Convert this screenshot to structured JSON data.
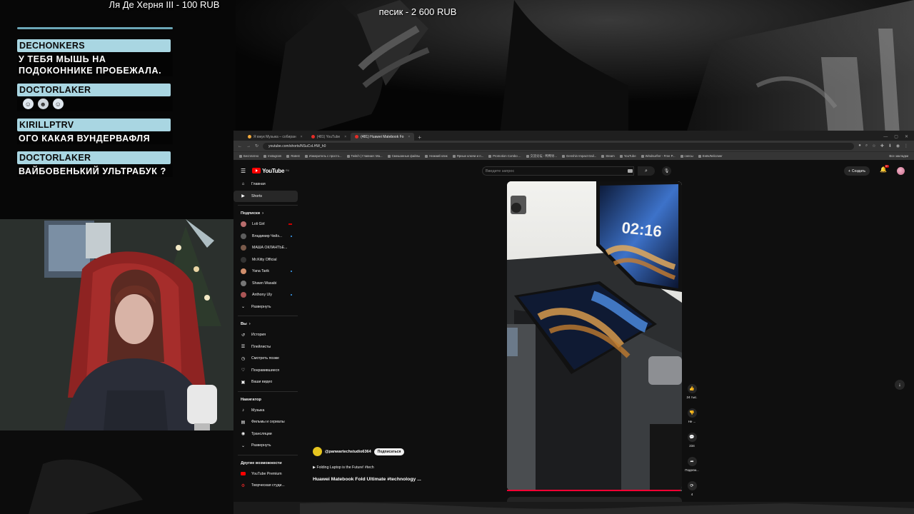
{
  "stream": {
    "donation_left": "Ля Де Херня III - 100 RUB",
    "donation_center": "песик - 2 600 RUB"
  },
  "chat": [
    {
      "name": "DECHONKERS",
      "text": "У ТЕБЯ МЫШЬ НА ПОДОКОННИКЕ ПРОБЕЖАЛА."
    },
    {
      "name": "DOCTORLAKER",
      "text": ""
    },
    {
      "name": "KIRILLPTRV",
      "text": "ОГО КАКАЯ ВУНДЕРВАФЛЯ"
    },
    {
      "name": "DOCTORLAKER",
      "text": "ВАЙБОВЕНЬКИЙ УЛЬТРАБУК ?"
    }
  ],
  "browser": {
    "tabs": [
      {
        "label": "Я вжук Музыка – собиран"
      },
      {
        "label": "(481) YouTube"
      },
      {
        "label": "(481) Huawei Matebook Fo"
      }
    ],
    "url": "youtube.com/shorts/NSuCvLHW_h0",
    "bookmarks": [
      "Бесплатно",
      "Instagram",
      "Ratest",
      "Измеритель с просто...",
      "Twitch | Главная: Ма...",
      "Смешанные файлы",
      "Нижний клик",
      "Ярные ключи и п...",
      "Promotion Combo ...",
      "交流论坛 - 鸭鸭导...",
      "Genshin Impact Dail...",
      "Steam",
      "YouTube",
      "Windsurfrer - Free P...",
      "снесы",
      "ЕнёкЛейслинг"
    ],
    "all_bookmarks": "Все закладки"
  },
  "youtube": {
    "search_placeholder": "Введите запрос",
    "create_label": "Создать",
    "notif_count": "9+",
    "sidebar": {
      "main": [
        {
          "label": "Главная",
          "icon": "home-icon"
        },
        {
          "label": "Shorts",
          "icon": "shorts-icon"
        }
      ],
      "subs_header": "Подписки",
      "subs": [
        {
          "label": "Loli Girl"
        },
        {
          "label": "Владимир Чейз..."
        },
        {
          "label": "МАША ОКЛАНТЬЕ..."
        },
        {
          "label": "Mr.Kitty Official"
        },
        {
          "label": "Yana Tarik"
        },
        {
          "label": "Shawn Wasabi"
        },
        {
          "label": "Anthony Uly"
        }
      ],
      "expand": "Развернуть",
      "you_header": "Вы",
      "you": [
        {
          "label": "История",
          "icon": "history-icon"
        },
        {
          "label": "Плейлисты",
          "icon": "playlists-icon"
        },
        {
          "label": "Смотреть позже",
          "icon": "watch-later-icon"
        },
        {
          "label": "Понравившиеся",
          "icon": "like-icon"
        },
        {
          "label": "Ваши видео",
          "icon": "your-videos-icon"
        }
      ],
      "nav_header": "Навигатор",
      "nav": [
        {
          "label": "Музыка",
          "icon": "music-icon"
        },
        {
          "label": "Фильмы и сериалы",
          "icon": "movies-icon"
        },
        {
          "label": "Трансляции",
          "icon": "live-icon"
        },
        {
          "label": "Развернуть",
          "icon": "chevron-down-icon"
        }
      ],
      "more_header": "Другие возможности",
      "more": [
        {
          "label": "YouTube Premium",
          "icon": "yt-premium-icon"
        },
        {
          "label": "Творческая студи...",
          "icon": "studio-icon"
        }
      ]
    },
    "short": {
      "clock": "02:16",
      "channel": "@panwartechstudio6364",
      "subscribe": "Подписаться",
      "music": "Folding Laptop is the Future! #tech",
      "title": "Huawei Matebook Fold Ultimate #technology ...",
      "likes": "24 тыс.",
      "dislike": "Не ...",
      "comments": "234",
      "share": "Подели...",
      "remix": "4",
      "progress": 0.99
    }
  }
}
